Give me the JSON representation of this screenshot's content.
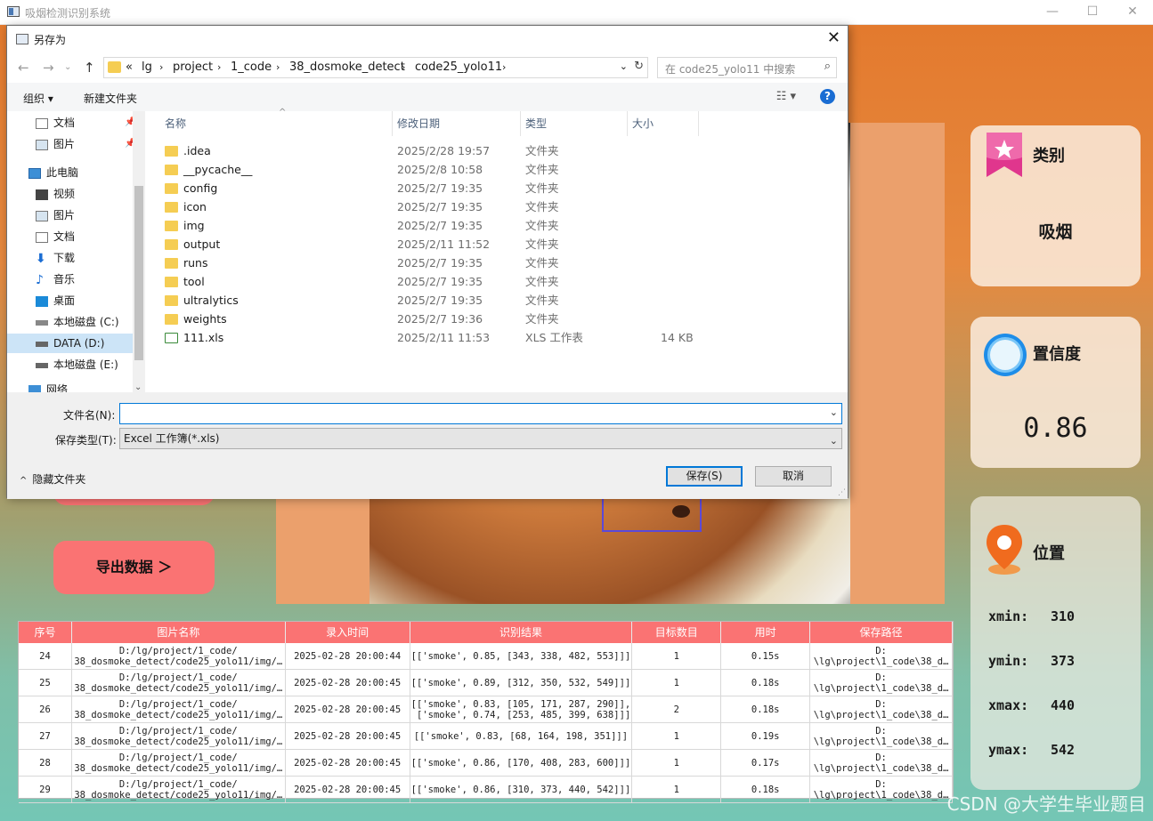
{
  "window": {
    "title": "吸烟检测识别系统",
    "minimize": "—",
    "maximize": "☐",
    "close": "✕"
  },
  "buttons": {
    "export": "导出数据 ＞"
  },
  "cards": {
    "category": {
      "label": "类别",
      "value": "吸烟"
    },
    "confidence": {
      "label": "置信度",
      "value": "0.86"
    },
    "position": {
      "label": "位置",
      "xmin_label": "xmin:",
      "xmin": "310",
      "ymin_label": "ymin:",
      "ymin": "373",
      "xmax_label": "xmax:",
      "xmax": "440",
      "ymax_label": "ymax:",
      "ymax": "542"
    }
  },
  "table": {
    "headers": [
      "序号",
      "图片名称",
      "录入时间",
      "识别结果",
      "目标数目",
      "用时",
      "保存路径"
    ],
    "rows": [
      {
        "id": "24",
        "name": "D:/lg/project/1_code/\n38_dosmoke_detect/code25_yolo11/img/…",
        "time": "2025-02-28 20:00:44",
        "result": "[['smoke', 0.85, [343, 338, 482, 553]]]",
        "count": "1",
        "cost": "0.15s",
        "path": "D:\n\\lg\\project\\1_code\\38_d…"
      },
      {
        "id": "25",
        "name": "D:/lg/project/1_code/\n38_dosmoke_detect/code25_yolo11/img/…",
        "time": "2025-02-28 20:00:45",
        "result": "[['smoke', 0.89, [312, 350, 532, 549]]]",
        "count": "1",
        "cost": "0.18s",
        "path": "D:\n\\lg\\project\\1_code\\38_d…"
      },
      {
        "id": "26",
        "name": "D:/lg/project/1_code/\n38_dosmoke_detect/code25_yolo11/img/…",
        "time": "2025-02-28 20:00:45",
        "result": "[['smoke', 0.83, [105, 171, 287, 290]],\n ['smoke', 0.74, [253, 485, 399, 638]]]",
        "count": "2",
        "cost": "0.18s",
        "path": "D:\n\\lg\\project\\1_code\\38_d…"
      },
      {
        "id": "27",
        "name": "D:/lg/project/1_code/\n38_dosmoke_detect/code25_yolo11/img/…",
        "time": "2025-02-28 20:00:45",
        "result": "[['smoke', 0.83, [68, 164, 198, 351]]]",
        "count": "1",
        "cost": "0.19s",
        "path": "D:\n\\lg\\project\\1_code\\38_d…"
      },
      {
        "id": "28",
        "name": "D:/lg/project/1_code/\n38_dosmoke_detect/code25_yolo11/img/…",
        "time": "2025-02-28 20:00:45",
        "result": "[['smoke', 0.86, [170, 408, 283, 600]]]",
        "count": "1",
        "cost": "0.17s",
        "path": "D:\n\\lg\\project\\1_code\\38_d…"
      },
      {
        "id": "29",
        "name": "D:/lg/project/1_code/\n38_dosmoke_detect/code25_yolo11/img/…",
        "time": "2025-02-28 20:00:45",
        "result": "[['smoke', 0.86, [310, 373, 440, 542]]]",
        "count": "1",
        "cost": "0.18s",
        "path": "D:\n\\lg\\project\\1_code\\38_d…"
      }
    ]
  },
  "watermark": "CSDN @大学生毕业题目",
  "dialog": {
    "title": "另存为",
    "close": "✕",
    "breadcrumb": [
      "«",
      "lg",
      "project",
      "1_code",
      "38_dosmoke_detect",
      "code25_yolo11"
    ],
    "search_placeholder": "在 code25_yolo11 中搜索",
    "toolbar": {
      "organize": "组织 ▾",
      "new_folder": "新建文件夹",
      "help": "?"
    },
    "nav": [
      "文档",
      "图片",
      "此电脑",
      "视频",
      "图片",
      "文档",
      "下载",
      "音乐",
      "桌面",
      "本地磁盘 (C:)",
      "DATA (D:)",
      "本地磁盘 (E:)",
      "网络"
    ],
    "columns": {
      "name": "名称",
      "date": "修改日期",
      "type": "类型",
      "size": "大小"
    },
    "files": [
      {
        "name": ".idea",
        "date": "2025/2/28 19:57",
        "type": "文件夹",
        "size": ""
      },
      {
        "name": "__pycache__",
        "date": "2025/2/8 10:58",
        "type": "文件夹",
        "size": ""
      },
      {
        "name": "config",
        "date": "2025/2/7 19:35",
        "type": "文件夹",
        "size": ""
      },
      {
        "name": "icon",
        "date": "2025/2/7 19:35",
        "type": "文件夹",
        "size": ""
      },
      {
        "name": "img",
        "date": "2025/2/7 19:35",
        "type": "文件夹",
        "size": ""
      },
      {
        "name": "output",
        "date": "2025/2/11 11:52",
        "type": "文件夹",
        "size": ""
      },
      {
        "name": "runs",
        "date": "2025/2/7 19:35",
        "type": "文件夹",
        "size": ""
      },
      {
        "name": "tool",
        "date": "2025/2/7 19:35",
        "type": "文件夹",
        "size": ""
      },
      {
        "name": "ultralytics",
        "date": "2025/2/7 19:35",
        "type": "文件夹",
        "size": ""
      },
      {
        "name": "weights",
        "date": "2025/2/7 19:36",
        "type": "文件夹",
        "size": ""
      },
      {
        "name": "111.xls",
        "date": "2025/2/11 11:53",
        "type": "XLS 工作表",
        "size": "14 KB"
      }
    ],
    "filename_label": "文件名(N):",
    "filename_value": "",
    "filetype_label": "保存类型(T):",
    "filetype_value": "Excel 工作簿(*.xls)",
    "hide_folders": "隐藏文件夹",
    "save": "保存(S)",
    "cancel": "取消"
  }
}
